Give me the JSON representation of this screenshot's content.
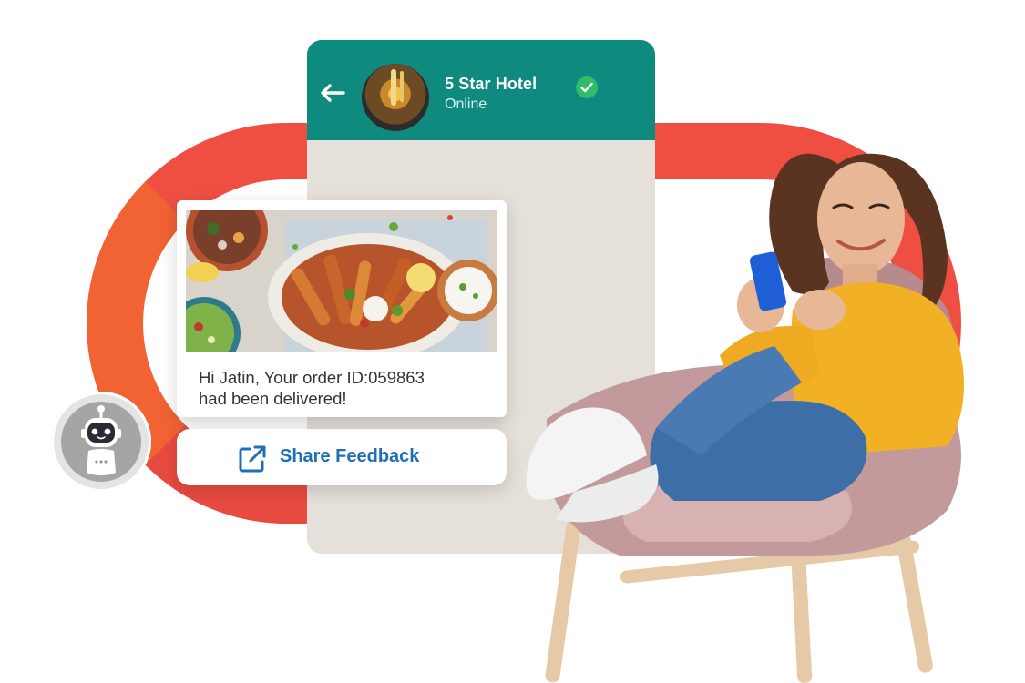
{
  "chat": {
    "contact_name": "5 Star Hotel",
    "contact_status": "Online"
  },
  "message": {
    "line1": "Hi Jatin, Your order ID:059863",
    "line2": "had been delivered!"
  },
  "action": {
    "share_feedback": "Share Feedback"
  },
  "icons": {
    "back": "arrow-left-icon",
    "verified": "verified-check-icon",
    "share": "external-link-icon",
    "bot": "robot-icon"
  },
  "colors": {
    "header": "#0f8a7f",
    "chat_background": "#e6e0da",
    "accent_ring": "#ef4f43",
    "button_text": "#1e6fb5",
    "verified": "#2fbd6b"
  }
}
